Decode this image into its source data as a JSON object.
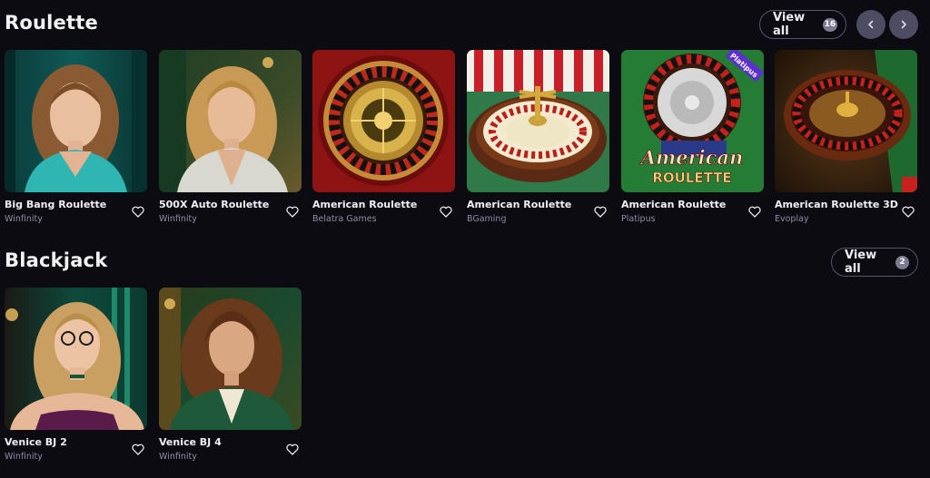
{
  "roulette": {
    "title": "Roulette",
    "view_all_label": "View all",
    "view_all_count": "16",
    "games": [
      {
        "title": "Big Bang Roulette",
        "provider": "Winfinity"
      },
      {
        "title": "500X Auto Roulette",
        "provider": "Winfinity"
      },
      {
        "title": "American Roulette",
        "provider": "Belatra Games"
      },
      {
        "title": "American Roulette",
        "provider": "BGaming"
      },
      {
        "title": "American Roulette",
        "provider": "Platipus",
        "thumb_text": "American",
        "thumb_text2": "ROULETTE",
        "thumb_tag": "Platipus"
      },
      {
        "title": "American Roulette 3D",
        "provider": "Evoplay"
      }
    ]
  },
  "blackjack": {
    "title": "Blackjack",
    "view_all_label": "View all",
    "view_all_count": "2",
    "games": [
      {
        "title": "Venice BJ 2",
        "provider": "Winfinity"
      },
      {
        "title": "Venice BJ 4",
        "provider": "Winfinity"
      }
    ]
  },
  "icons": {
    "prev": "chevron-left-icon",
    "next": "chevron-right-icon",
    "favorite": "heart-icon"
  },
  "colors": {
    "background": "#0c0b12",
    "nav_button": "#4d4c63",
    "badge": "#7c7b92",
    "provider_text": "#8e8da2"
  }
}
